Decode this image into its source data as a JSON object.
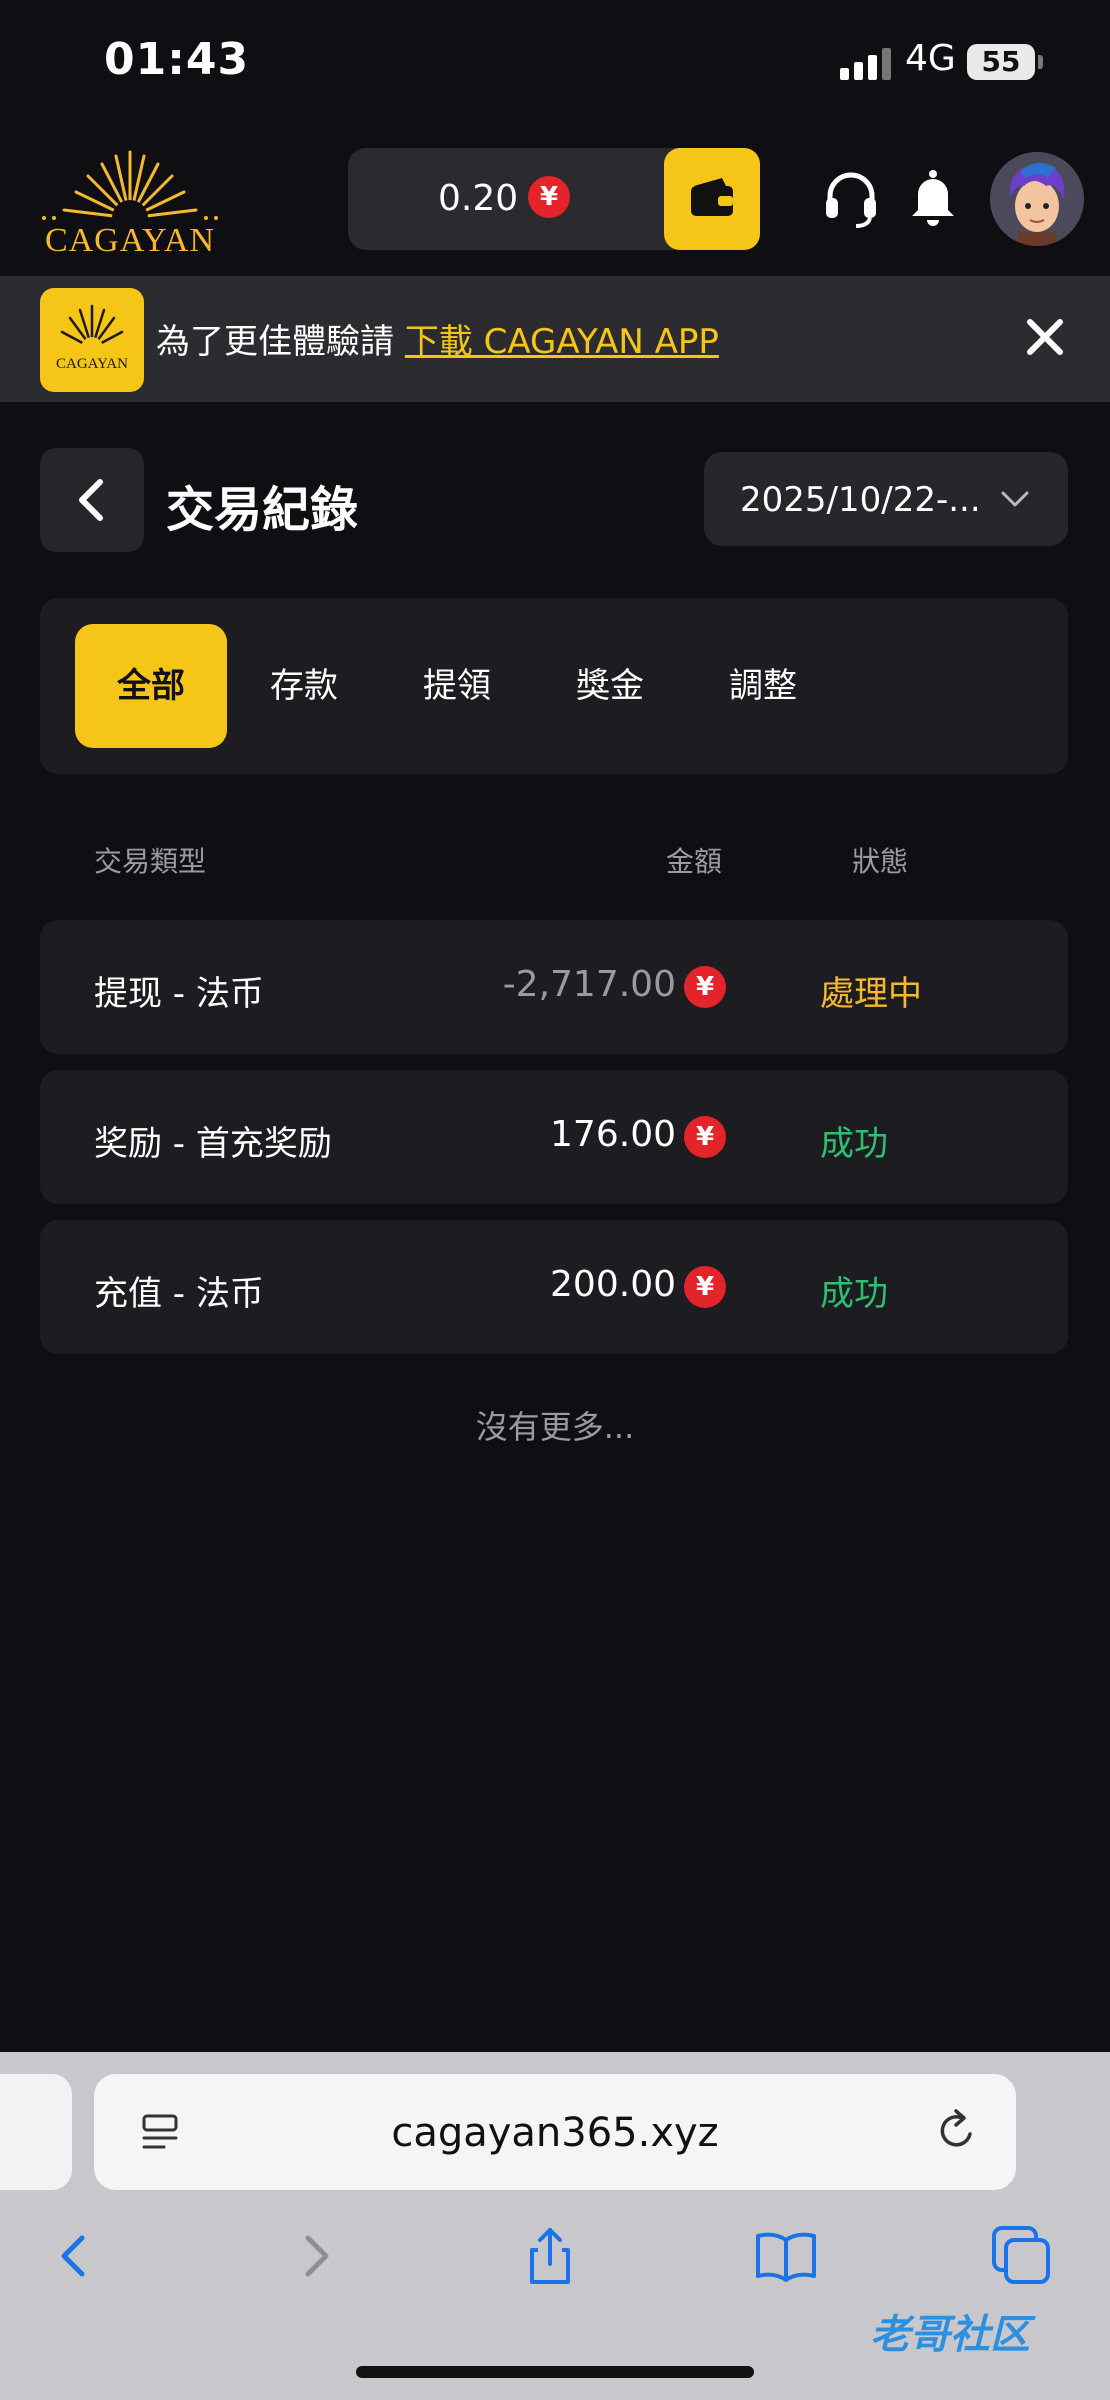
{
  "status_bar": {
    "time": "01:43",
    "network": "4G",
    "battery": "55"
  },
  "header": {
    "logo_text": "CAGAYAN",
    "balance": "0.20",
    "currency_symbol": "¥"
  },
  "banner": {
    "logo_text": "CAGAYAN",
    "prompt": "為了更佳體驗請 ",
    "link": "下載 CAGAYAN APP"
  },
  "page": {
    "title": "交易紀錄",
    "date_range": "2025/10/22-..."
  },
  "tabs": [
    {
      "label": "全部",
      "active": true
    },
    {
      "label": "存款",
      "active": false
    },
    {
      "label": "提領",
      "active": false
    },
    {
      "label": "獎金",
      "active": false
    },
    {
      "label": "調整",
      "active": false
    }
  ],
  "table": {
    "headers": {
      "type": "交易類型",
      "amount": "金額",
      "status": "狀態"
    },
    "rows": [
      {
        "type": "提现 - 法币",
        "amount": "-2,717.00",
        "status": "處理中",
        "amount_color": "#9a9aa1",
        "status_color": "#f5b82e"
      },
      {
        "type": "奖励 - 首充奖励",
        "amount": "176.00",
        "status": "成功",
        "amount_color": "#ffffff",
        "status_color": "#2fbf71"
      },
      {
        "type": "充值 - 法币",
        "amount": "200.00",
        "status": "成功",
        "amount_color": "#ffffff",
        "status_color": "#2fbf71"
      }
    ],
    "no_more": "沒有更多..."
  },
  "browser": {
    "url": "cagayan365.xyz"
  },
  "watermark": "老哥社区"
}
